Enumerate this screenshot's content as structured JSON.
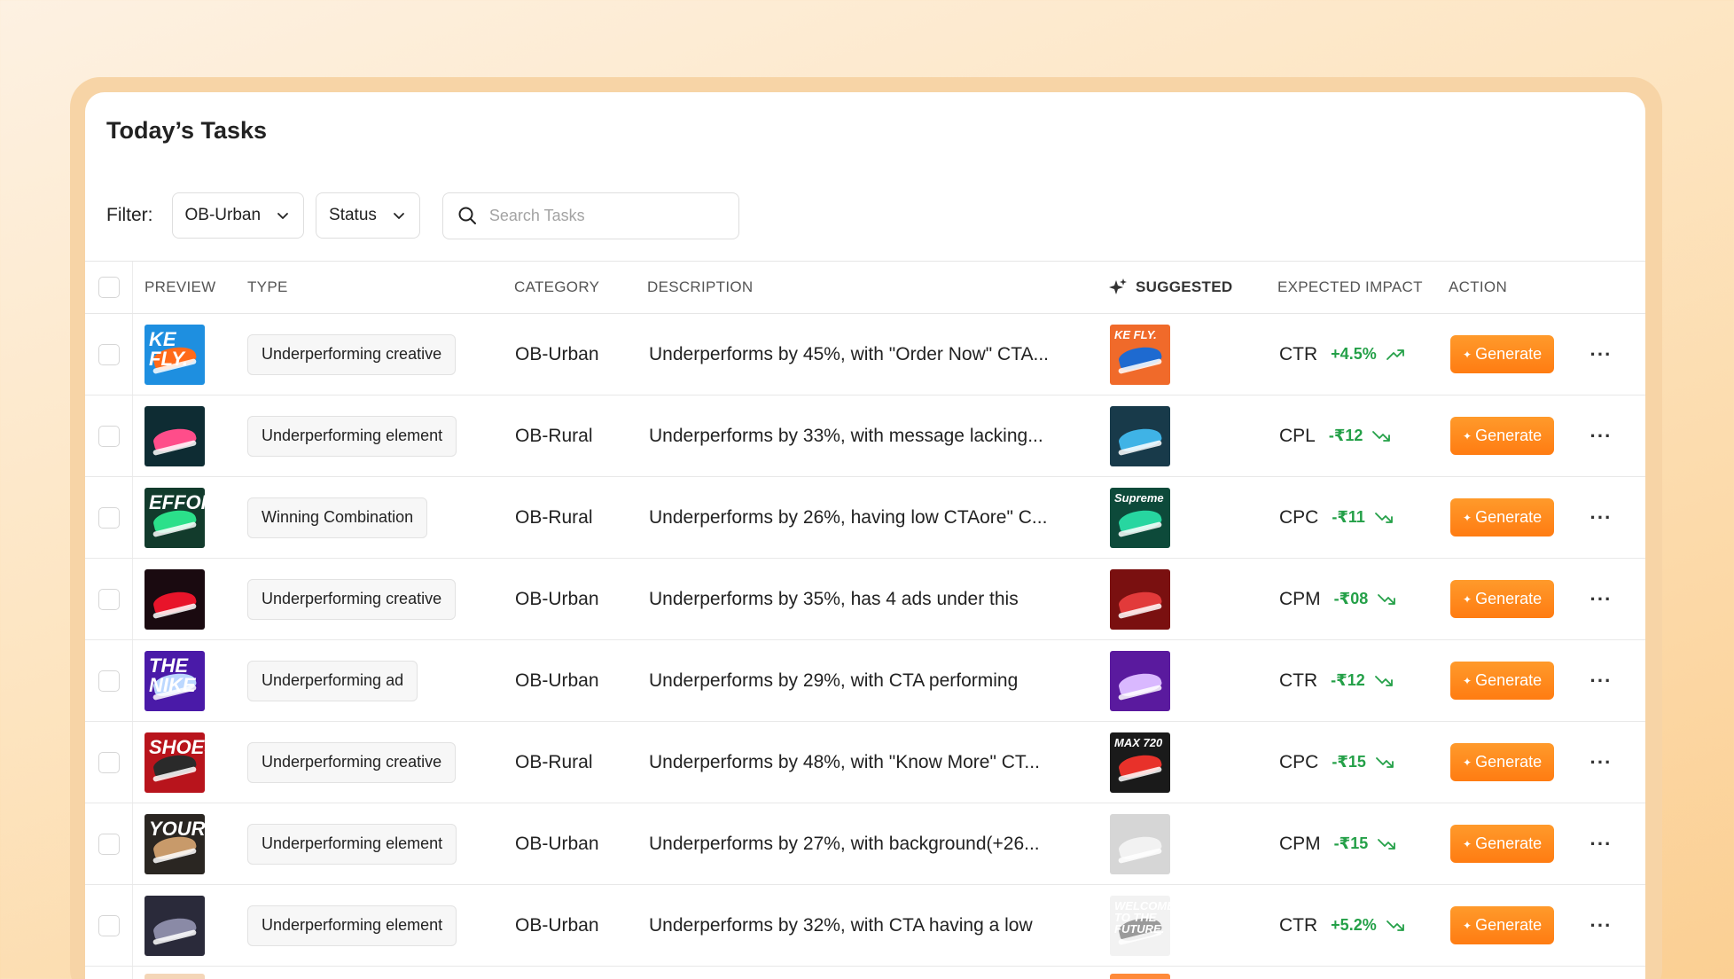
{
  "page": {
    "title": "Today’s Tasks"
  },
  "filters": {
    "label": "Filter:",
    "category_value": "OB-Urban",
    "status_value": "Status",
    "search_placeholder": "Search Tasks"
  },
  "columns": {
    "preview": "PREVIEW",
    "type": "TYPE",
    "category": "CATEGORY",
    "description": "DESCRIPTION",
    "suggested": "SUGGESTED",
    "expected_impact": "EXPECTED IMPACT",
    "action": "ACTION"
  },
  "action_label": "Generate",
  "more_label": "···",
  "colors": {
    "accent_orange": "#ff8a1e",
    "positive_green": "#24a048"
  },
  "rows": [
    {
      "type": "Underperforming creative",
      "category": "OB-Urban",
      "description": "Underperforms by 45%, with \"Order Now\" CTA...",
      "metric": "CTR",
      "delta": "+4.5%",
      "trend": "up",
      "preview_text": "KE FLY.",
      "preview_bg": "#1e8fe0",
      "preview_shoe": "#ff6a1a",
      "suggested_text": "KE FLY.",
      "suggested_bg": "#f06a2a",
      "suggested_shoe": "#1e6ad0"
    },
    {
      "type": "Underperforming element",
      "category": "OB-Rural",
      "description": "Underperforms by 33%, with message lacking...",
      "metric": "CPL",
      "delta": "-₹12",
      "trend": "down",
      "preview_text": "",
      "preview_bg": "#0e2c33",
      "preview_shoe": "#ff4d8a",
      "suggested_text": "",
      "suggested_bg": "#183a4a",
      "suggested_shoe": "#3fb3e6"
    },
    {
      "type": "Winning Combination",
      "category": "OB-Rural",
      "description": "Underperforms by 26%, having low CTAore\" C...",
      "metric": "CPC",
      "delta": "-₹11",
      "trend": "down",
      "preview_text": "EFFORTLESS.",
      "preview_bg": "#123b2c",
      "preview_shoe": "#2be08a",
      "suggested_text": "Supreme",
      "suggested_bg": "#0d4a3a",
      "suggested_shoe": "#27d6a0"
    },
    {
      "type": "Underperforming creative",
      "category": "OB-Urban",
      "description": "Underperforms by 35%, has 4 ads under this",
      "metric": "CPM",
      "delta": "-₹08",
      "trend": "down",
      "preview_text": "",
      "preview_bg": "#1a0a10",
      "preview_shoe": "#e8142a",
      "suggested_text": "",
      "suggested_bg": "#7a1010",
      "suggested_shoe": "#e23a3a"
    },
    {
      "type": "Underperforming ad",
      "category": "OB-Urban",
      "description": "Underperforms by 29%, with CTA performing",
      "metric": "CTR",
      "delta": "-₹12",
      "trend": "down",
      "preview_text": "THE NIKE",
      "preview_bg": "#4a1aa8",
      "preview_shoe": "#bcd8ff",
      "suggested_text": "",
      "suggested_bg": "#5a1a9e",
      "suggested_shoe": "#d9b8ff"
    },
    {
      "type": "Underperforming creative",
      "category": "OB-Rural",
      "description": "Underperforms by 48%, with \"Know More\" CT...",
      "metric": "CPC",
      "delta": "-₹15",
      "trend": "down",
      "preview_text": "SHOES",
      "preview_bg": "#b8141c",
      "preview_shoe": "#2a2a2a",
      "suggested_text": "MAX 720",
      "suggested_bg": "#1a1a1a",
      "suggested_shoe": "#e8312a"
    },
    {
      "type": "Underperforming element",
      "category": "OB-Urban",
      "description": "Underperforms by 27%, with background(+26...",
      "metric": "CPM",
      "delta": "-₹15",
      "trend": "down",
      "preview_text": "YOURSELF",
      "preview_bg": "#2a2622",
      "preview_shoe": "#c89a6a",
      "suggested_text": "",
      "suggested_bg": "#d6d6d6",
      "suggested_shoe": "#f2f2f2"
    },
    {
      "type": "Underperforming element",
      "category": "OB-Urban",
      "description": "Underperforms by 32%, with CTA having a low",
      "metric": "CTR",
      "delta": "+5.2%",
      "trend": "down",
      "preview_text": "",
      "preview_bg": "#2a2a3a",
      "preview_shoe": "#8a8aa6",
      "suggested_text": "WELCOME TO THE FUTURE.",
      "suggested_bg": "#f2f2f2",
      "suggested_shoe": "#9a9a9a"
    }
  ]
}
